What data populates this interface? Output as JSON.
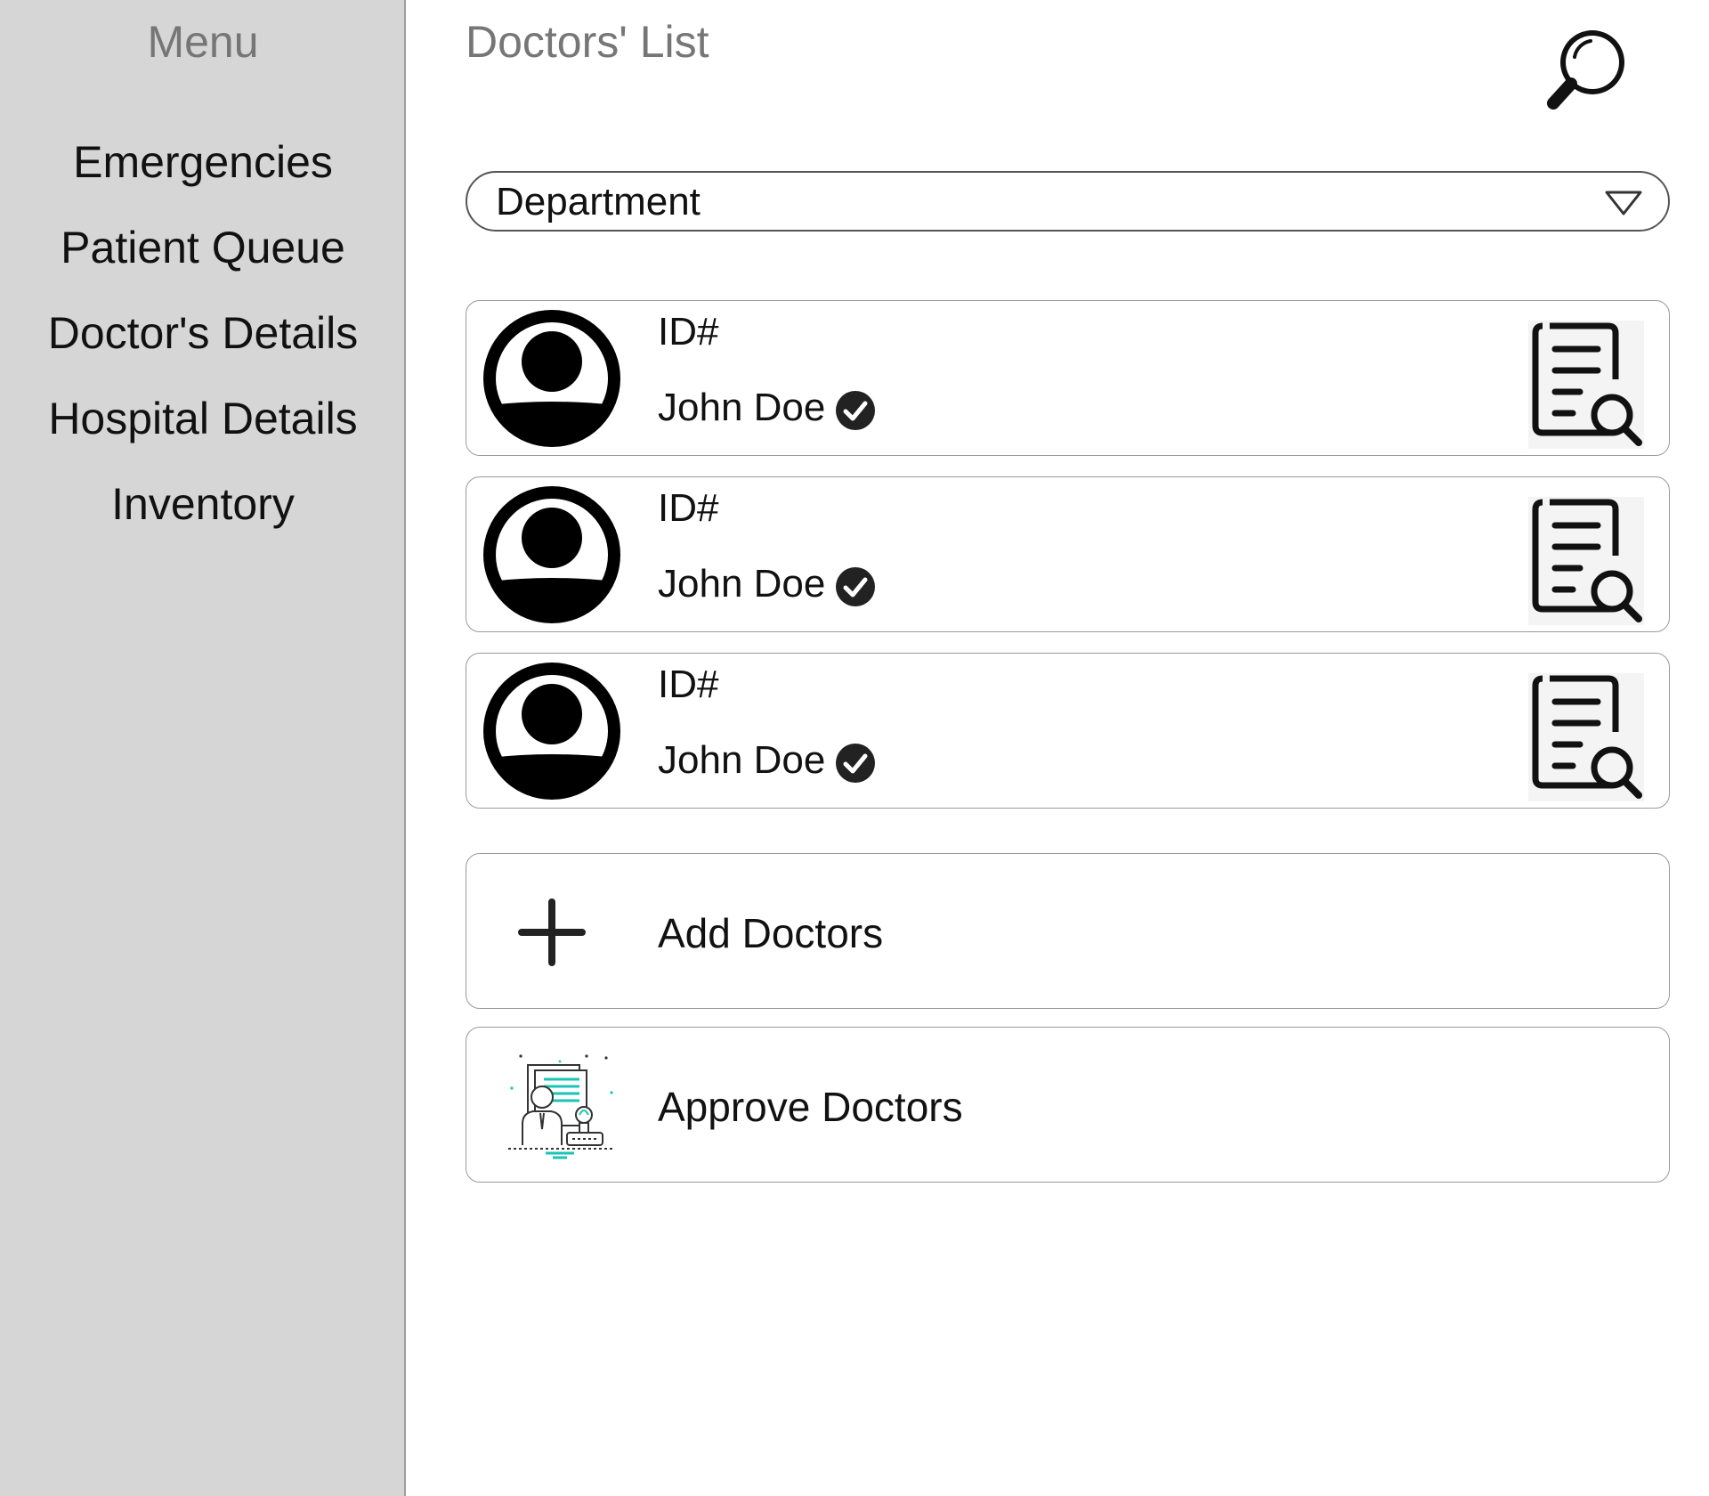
{
  "sidebar": {
    "title": "Menu",
    "items": [
      {
        "label": "Emergencies"
      },
      {
        "label": "Patient Queue"
      },
      {
        "label": "Doctor's Details"
      },
      {
        "label": "Hospital Details"
      },
      {
        "label": "Inventory"
      }
    ]
  },
  "header": {
    "title": "Doctors' List",
    "search_icon": "magnifier-icon"
  },
  "filter": {
    "label": "Department",
    "icon": "dropdown-triangle-icon"
  },
  "doctors": [
    {
      "id_label": "ID#",
      "name": "John Doe",
      "verified": true
    },
    {
      "id_label": "ID#",
      "name": "John Doe",
      "verified": true
    },
    {
      "id_label": "ID#",
      "name": "John Doe",
      "verified": true
    }
  ],
  "actions": {
    "add_label": "Add Doctors",
    "approve_label": "Approve Doctors"
  },
  "colors": {
    "sidebar_bg": "#d6d6d6",
    "muted_text": "#767676",
    "accent_teal": "#19c4b5"
  }
}
